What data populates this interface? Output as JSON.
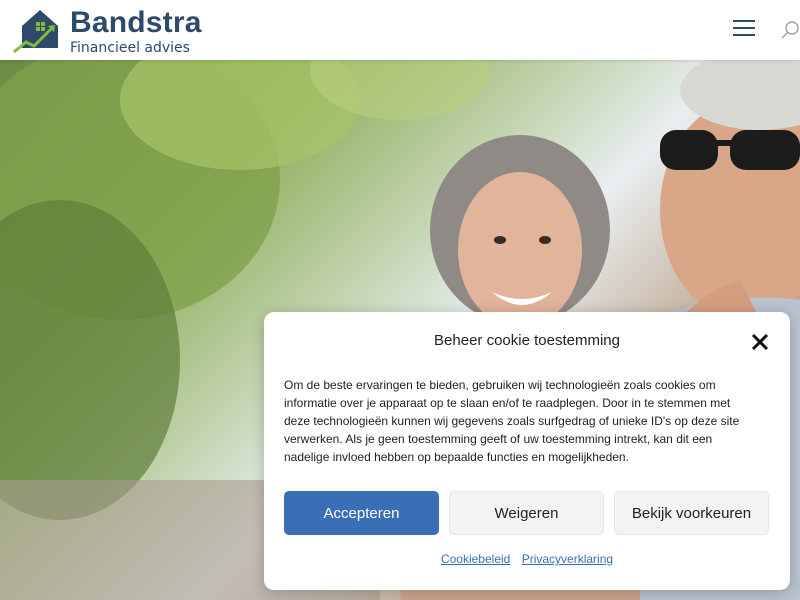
{
  "header": {
    "logo": {
      "name": "Bandstra",
      "tagline": "Financieel advies"
    },
    "menu_icon": "hamburger-icon",
    "search_icon": "search-icon"
  },
  "hero": {
    "image": "senior-couple-photo"
  },
  "cookie_modal": {
    "title": "Beheer cookie toestemming",
    "close_icon": "close-icon",
    "body": "Om de beste ervaringen te bieden, gebruiken wij technologieën zoals cookies om informatie over je apparaat op te slaan en/of te raadplegen. Door in te stemmen met deze technologieën kunnen wij gegevens zoals surfgedrag of unieke ID's op deze site verwerken. Als je geen toestemming geeft of uw toestemming intrekt, kan dit een nadelige invloed hebben op bepaalde functies en mogelijkheden.",
    "buttons": {
      "accept": "Accepteren",
      "deny": "Weigeren",
      "preferences": "Bekijk voorkeuren"
    },
    "links": {
      "cookie_policy": "Cookiebeleid",
      "privacy": "Privacyverklaring"
    }
  },
  "colors": {
    "brand": "#2e4a6b",
    "accent_green": "#7bbf3a",
    "button_primary": "#3a6fb6"
  }
}
